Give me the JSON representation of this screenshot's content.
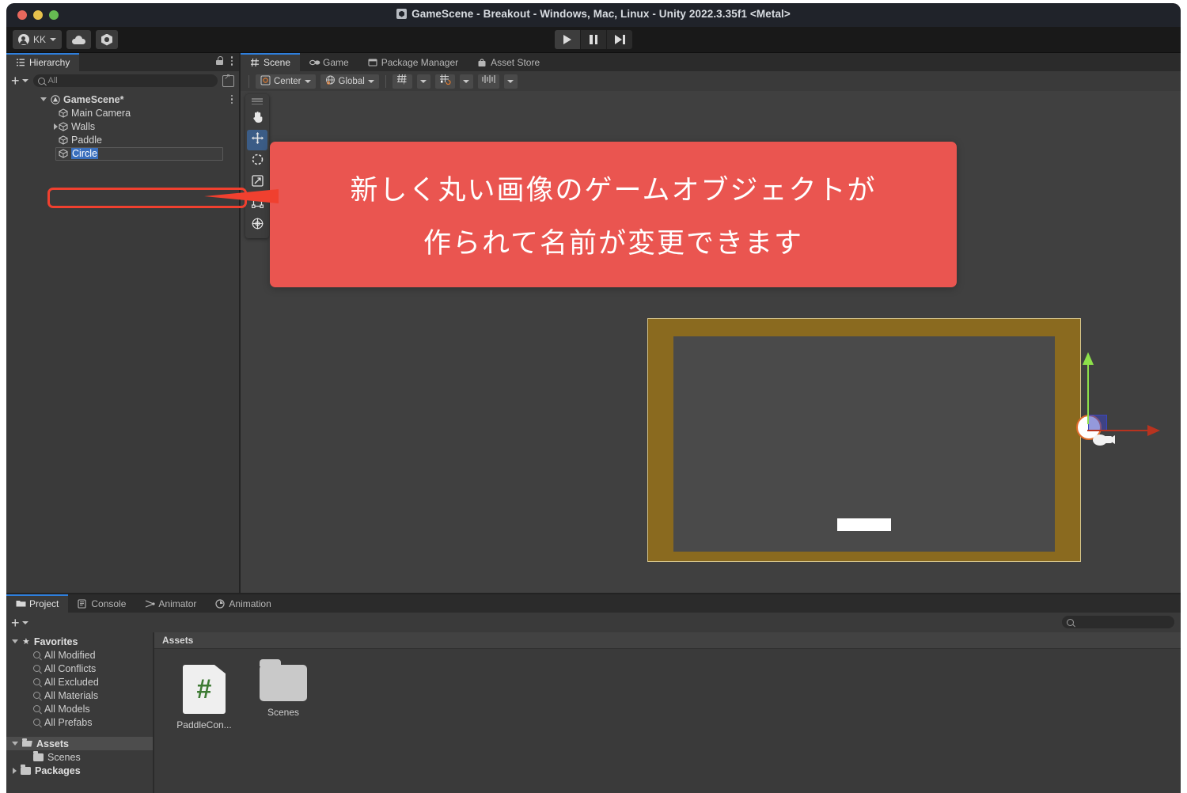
{
  "window": {
    "title": "GameScene - Breakout - Windows, Mac, Linux - Unity 2022.3.35f1 <Metal>",
    "traffic_lights": [
      "close",
      "minimize",
      "zoom"
    ]
  },
  "toolbar": {
    "account_label": "KK",
    "cloud_icon": "cloud-icon",
    "services_icon": "unity-services-icon",
    "play_icon": "play-icon",
    "pause_icon": "pause-icon",
    "step_icon": "step-icon"
  },
  "hierarchy": {
    "tab_label": "Hierarchy",
    "tab_icon": "hierarchy-icon",
    "lock_icon": "lock-icon",
    "menu_icon": "kebab-menu-icon",
    "add_label": "+",
    "search_placeholder": "All",
    "items": [
      {
        "label": "GameScene*",
        "depth": 0,
        "expanded": true,
        "icon": "scene-icon"
      },
      {
        "label": "Main Camera",
        "depth": 1,
        "expanded": null,
        "icon": "gameobject-icon"
      },
      {
        "label": "Walls",
        "depth": 1,
        "expanded": false,
        "icon": "gameobject-icon"
      },
      {
        "label": "Paddle",
        "depth": 1,
        "expanded": null,
        "icon": "gameobject-icon"
      },
      {
        "label": "Circle",
        "depth": 1,
        "expanded": null,
        "icon": "gameobject-icon",
        "renaming": true,
        "text_selected": true
      }
    ]
  },
  "scene_view": {
    "tabs": [
      {
        "label": "Scene",
        "icon": "scene-grid-icon",
        "active": true
      },
      {
        "label": "Game",
        "icon": "gamepad-icon",
        "active": false
      },
      {
        "label": "Package Manager",
        "icon": "package-icon",
        "active": false
      },
      {
        "label": "Asset Store",
        "icon": "store-icon",
        "active": false
      }
    ],
    "toolbar": {
      "pivot_mode": "Center",
      "pivot_icon": "pivot-center-icon",
      "handle_space": "Global",
      "space_icon": "globe-icon",
      "grid_icon": "grid-visibility-icon",
      "snap_icon": "grid-snapping-icon",
      "ruler_icon": "component-tools-icon",
      "dropdown_icon": "chevron-down-icon"
    },
    "tools": [
      {
        "name": "hand-tool",
        "selected": false
      },
      {
        "name": "move-tool",
        "selected": true
      },
      {
        "name": "rotate-tool",
        "selected": false
      },
      {
        "name": "scale-tool",
        "selected": false
      },
      {
        "name": "rect-tool",
        "selected": false
      },
      {
        "name": "transform-tool",
        "selected": false
      }
    ],
    "gizmo": {
      "x_axis_color": "#b8331f",
      "y_axis_color": "#8de04a",
      "plane_color": "#3a46be"
    },
    "objects": {
      "walls_color": "#8a6a1f",
      "ball_color": "#ffffff",
      "ball_outline_color": "#e06c2a",
      "paddle_color": "#ffffff",
      "background_color": "#4a4a4a"
    }
  },
  "callout": {
    "line1": "新しく丸い画像のゲームオブジェクトが",
    "line2": "作られて名前が変更できます",
    "color": "#ea5550",
    "highlight_color": "#f0402f"
  },
  "project": {
    "tabs": [
      {
        "label": "Project",
        "icon": "folder-icon",
        "active": true
      },
      {
        "label": "Console",
        "icon": "console-icon",
        "active": false
      },
      {
        "label": "Animator",
        "icon": "animator-icon",
        "active": false
      },
      {
        "label": "Animation",
        "icon": "animation-clock-icon",
        "active": false
      }
    ],
    "add_label": "+",
    "search_placeholder": "",
    "tree": [
      {
        "label": "Favorites",
        "depth": 0,
        "icon": "star-icon",
        "expanded": true,
        "bold": true
      },
      {
        "label": "All Modified",
        "depth": 1,
        "icon": "search-icon"
      },
      {
        "label": "All Conflicts",
        "depth": 1,
        "icon": "search-icon"
      },
      {
        "label": "All Excluded",
        "depth": 1,
        "icon": "search-icon"
      },
      {
        "label": "All Materials",
        "depth": 1,
        "icon": "search-icon"
      },
      {
        "label": "All Models",
        "depth": 1,
        "icon": "search-icon"
      },
      {
        "label": "All Prefabs",
        "depth": 1,
        "icon": "search-icon"
      },
      {
        "label": "Assets",
        "depth": 0,
        "icon": "folder-open-icon",
        "expanded": true,
        "bold": true,
        "selected": true
      },
      {
        "label": "Scenes",
        "depth": 1,
        "icon": "folder-icon"
      },
      {
        "label": "Packages",
        "depth": 0,
        "icon": "folder-icon",
        "expanded": false,
        "bold": true
      }
    ],
    "breadcrumb": "Assets",
    "assets": [
      {
        "label": "PaddleCon...",
        "icon": "csharp-script-icon"
      },
      {
        "label": "Scenes",
        "icon": "folder-icon"
      }
    ]
  }
}
